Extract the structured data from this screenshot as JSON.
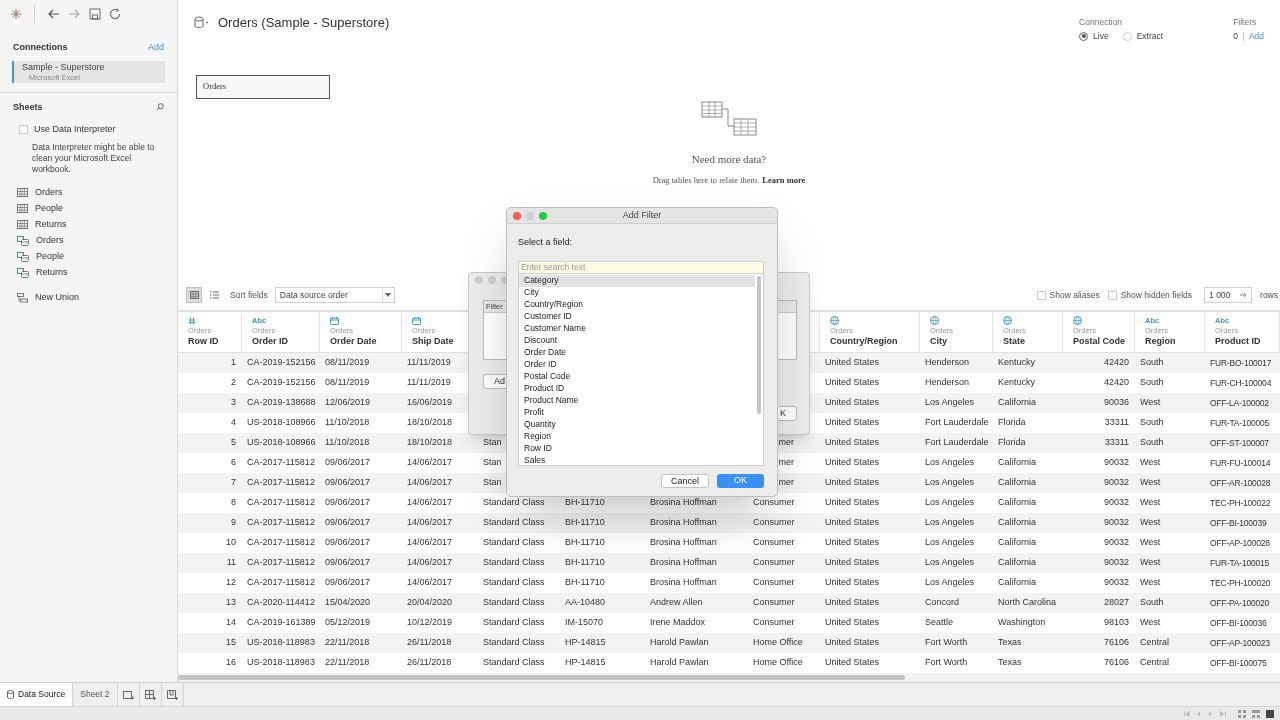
{
  "sidebar": {
    "connections_title": "Connections",
    "add_link": "Add",
    "connections": [
      {
        "name": "Sample - Superstore",
        "type": "Microsoft Excel",
        "selected": true
      }
    ],
    "sheets_title": "Sheets",
    "interpreter": {
      "label": "Use Data Interpreter",
      "checked": false,
      "description": "Data Interpreter might be able to clean your Microsoft Excel workbook."
    },
    "sheets": [
      {
        "name": "Orders",
        "kind": "table"
      },
      {
        "name": "People",
        "kind": "table"
      },
      {
        "name": "Returns",
        "kind": "table"
      },
      {
        "name": "Orders",
        "kind": "range"
      },
      {
        "name": "People",
        "kind": "range"
      },
      {
        "name": "Returns",
        "kind": "range"
      }
    ],
    "new_union": "New Union"
  },
  "header": {
    "title": "Orders (Sample - Superstore)",
    "connection": {
      "label": "Connection",
      "options": [
        {
          "label": "Live",
          "selected": true
        },
        {
          "label": "Extract",
          "selected": false
        }
      ]
    },
    "filters": {
      "label": "Filters",
      "count": "0",
      "add": "Add"
    }
  },
  "canvas": {
    "tables": [
      {
        "name": "Orders"
      }
    ],
    "prompt_title": "Need more data?",
    "prompt_text": "Drag tables here to relate them.",
    "prompt_link": "Learn more"
  },
  "grid_toolbar": {
    "views": [
      {
        "kind": "grid",
        "selected": true
      },
      {
        "kind": "list",
        "selected": false
      }
    ],
    "sort_label": "Sort fields",
    "sort_value": "Data source order",
    "options": [
      {
        "label": "Show aliases",
        "checked": false
      },
      {
        "label": "Show hidden fields",
        "checked": false
      }
    ],
    "rows_value": "1 000",
    "rows_label": "rows"
  },
  "table": {
    "columns": [
      {
        "kind": "number",
        "source": "Orders",
        "label": "Row ID"
      },
      {
        "kind": "string",
        "badge": "Abc",
        "source": "Orders",
        "label": "Order ID"
      },
      {
        "kind": "date",
        "source": "Orders",
        "label": "Order Date"
      },
      {
        "kind": "date",
        "source": "Orders",
        "label": "Ship Date"
      },
      null,
      null,
      null,
      null,
      {
        "kind": "geo",
        "source": "Orders",
        "label": "Country/Region"
      },
      {
        "kind": "geo",
        "source": "Orders",
        "label": "City"
      },
      {
        "kind": "geo",
        "source": "Orders",
        "label": "State"
      },
      {
        "kind": "geo",
        "source": "Orders",
        "label": "Postal Code"
      },
      {
        "kind": "string",
        "badge": "Abc",
        "source": "Orders",
        "label": "Region"
      },
      {
        "kind": "string",
        "badge": "Abc",
        "source": "Orders",
        "label": "Product ID"
      }
    ],
    "rows": [
      [
        "1",
        "CA-2019-152156",
        "08/11/2019",
        "11/11/2019",
        null,
        null,
        null,
        null,
        "United States",
        "Henderson",
        "Kentucky",
        "42420",
        "South",
        "FUR-BO-100017"
      ],
      [
        "2",
        "CA-2019-152156",
        "08/11/2019",
        "11/11/2019",
        null,
        null,
        null,
        null,
        "United States",
        "Henderson",
        "Kentucky",
        "42420",
        "South",
        "FUR-CH-100004"
      ],
      [
        "3",
        "CA-2019-138688",
        "12/06/2019",
        "16/06/2019",
        null,
        null,
        null,
        null,
        "United States",
        "Los Angeles",
        "California",
        "90036",
        "West",
        "OFF-LA-100002"
      ],
      [
        "4",
        "US-2018-108966",
        "11/10/2018",
        "18/10/2018",
        null,
        null,
        null,
        null,
        "United States",
        "Fort Lauderdale",
        "Florida",
        "33311",
        "South",
        "FUR-TA-100005"
      ],
      [
        "5",
        "US-2018-108966",
        "11/10/2018",
        "18/10/2018",
        "Stan",
        null,
        null,
        "mer",
        "United States",
        "Fort Lauderdale",
        "Florida",
        "33311",
        "South",
        "OFF-ST-100007"
      ],
      [
        "6",
        "CA-2017-115812",
        "09/06/2017",
        "14/06/2017",
        "Stan",
        null,
        null,
        "mer",
        "United States",
        "Los Angeles",
        "California",
        "90032",
        "West",
        "FUR-FU-100014"
      ],
      [
        "7",
        "CA-2017-115812",
        "09/06/2017",
        "14/06/2017",
        "Stan",
        null,
        null,
        "mer",
        "United States",
        "Los Angeles",
        "California",
        "90032",
        "West",
        "OFF-AR-100028"
      ],
      [
        "8",
        "CA-2017-115812",
        "09/06/2017",
        "14/06/2017",
        "Standard Class",
        "BH-11710",
        "Brosina Hoffman",
        "Consumer",
        "United States",
        "Los Angeles",
        "California",
        "90032",
        "West",
        "TEC-PH-100022"
      ],
      [
        "9",
        "CA-2017-115812",
        "09/06/2017",
        "14/06/2017",
        "Standard Class",
        "BH-11710",
        "Brosina Hoffman",
        "Consumer",
        "United States",
        "Los Angeles",
        "California",
        "90032",
        "West",
        "OFF-BI-100039"
      ],
      [
        "10",
        "CA-2017-115812",
        "09/06/2017",
        "14/06/2017",
        "Standard Class",
        "BH-11710",
        "Brosina Hoffman",
        "Consumer",
        "United States",
        "Los Angeles",
        "California",
        "90032",
        "West",
        "OFF-AP-100028"
      ],
      [
        "11",
        "CA-2017-115812",
        "09/06/2017",
        "14/06/2017",
        "Standard Class",
        "BH-11710",
        "Brosina Hoffman",
        "Consumer",
        "United States",
        "Los Angeles",
        "California",
        "90032",
        "West",
        "FUR-TA-100015"
      ],
      [
        "12",
        "CA-2017-115812",
        "09/06/2017",
        "14/06/2017",
        "Standard Class",
        "BH-11710",
        "Brosina Hoffman",
        "Consumer",
        "United States",
        "Los Angeles",
        "California",
        "90032",
        "West",
        "TEC-PH-100020"
      ],
      [
        "13",
        "CA-2020-114412",
        "15/04/2020",
        "20/04/2020",
        "Standard Class",
        "AA-10480",
        "Andrew Allen",
        "Consumer",
        "United States",
        "Concord",
        "North Carolina",
        "28027",
        "South",
        "OFF-PA-100020"
      ],
      [
        "14",
        "CA-2019-161389",
        "05/12/2019",
        "10/12/2019",
        "Standard Class",
        "IM-15070",
        "Irene Maddox",
        "Consumer",
        "United States",
        "Seattle",
        "Washington",
        "98103",
        "West",
        "OFF-BI-100036"
      ],
      [
        "15",
        "US-2018-118983",
        "22/11/2018",
        "26/11/2018",
        "Standard Class",
        "HP-14815",
        "Harold Pawlan",
        "Home Office",
        "United States",
        "Fort Worth",
        "Texas",
        "76106",
        "Central",
        "OFF-AP-100023"
      ],
      [
        "16",
        "US-2018-118983",
        "22/11/2018",
        "26/11/2018",
        "Standard Class",
        "HP-14815",
        "Harold Pawlan",
        "Home Office",
        "United States",
        "Fort Worth",
        "Texas",
        "76106",
        "Central",
        "OFF-BI-100075"
      ]
    ]
  },
  "filters_dialog": {
    "column_header": "Filter",
    "add_button": "Ad",
    "ok_button": "K"
  },
  "add_filter_dialog": {
    "title": "Add Filter",
    "prompt": "Select a field:",
    "search_placeholder": "Enter search text",
    "fields": [
      {
        "label": "Category",
        "selected": true
      },
      {
        "label": "City",
        "selected": false
      },
      {
        "label": "Country/Region",
        "selected": false
      },
      {
        "label": "Customer ID",
        "selected": false
      },
      {
        "label": "Customer Name",
        "selected": false
      },
      {
        "label": "Discount",
        "selected": false
      },
      {
        "label": "Order Date",
        "selected": false
      },
      {
        "label": "Order ID",
        "selected": false
      },
      {
        "label": "Postal Code",
        "selected": false
      },
      {
        "label": "Product ID",
        "selected": false
      },
      {
        "label": "Product Name",
        "selected": false
      },
      {
        "label": "Profit",
        "selected": false
      },
      {
        "label": "Quantity",
        "selected": false
      },
      {
        "label": "Region",
        "selected": false
      },
      {
        "label": "Row ID",
        "selected": false
      },
      {
        "label": "Sales",
        "selected": false
      }
    ],
    "cancel": "Cancel",
    "ok": "OK"
  },
  "tabs": [
    {
      "label": "Data Source",
      "kind": "data",
      "selected": true
    },
    {
      "label": "Sheet 2",
      "kind": "sheet",
      "selected": false
    }
  ]
}
